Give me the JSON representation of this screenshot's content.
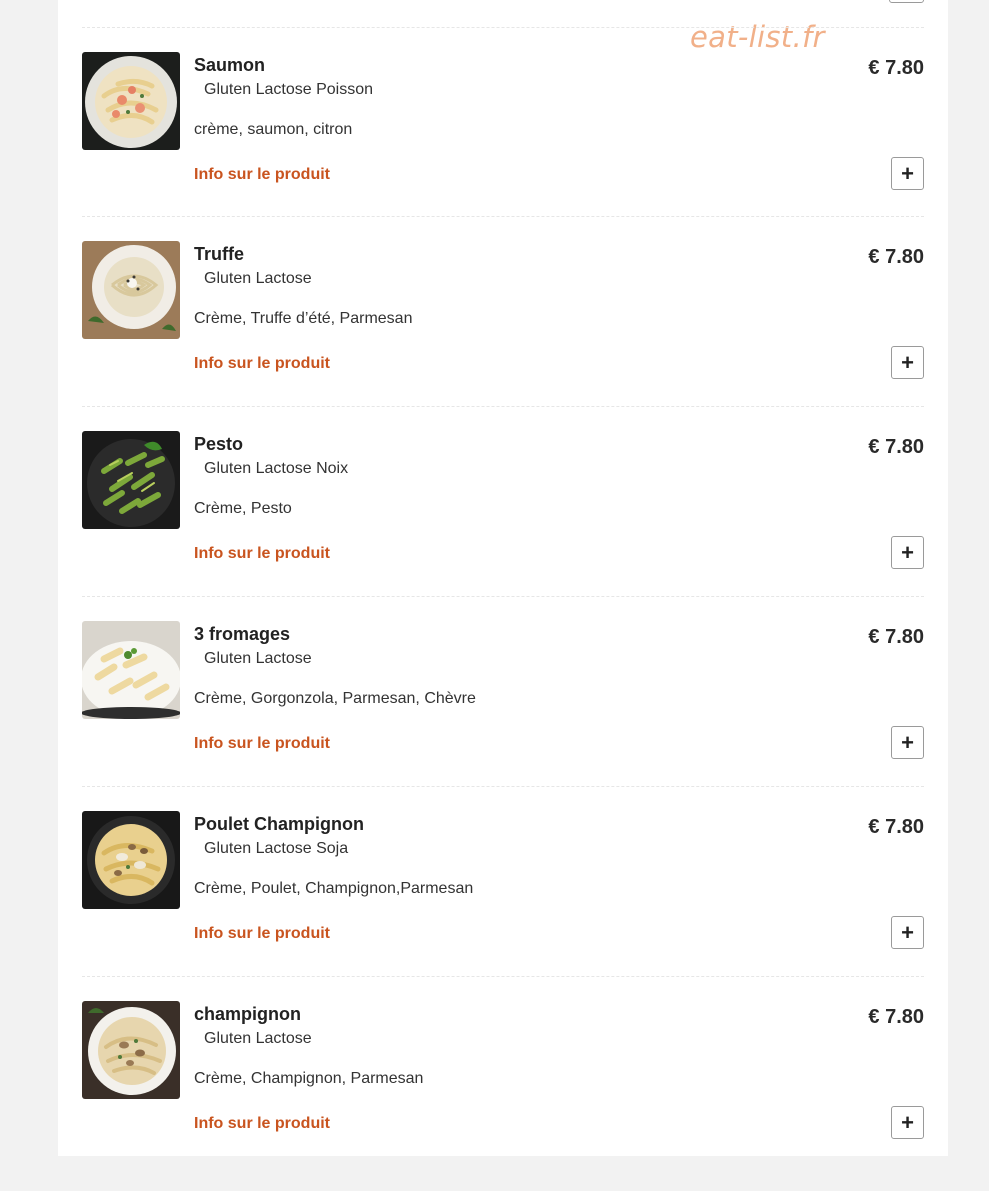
{
  "watermark": "eat-list.fr",
  "items": [
    {
      "name": "Saumon",
      "allergens": "Gluten Lactose Poisson",
      "description": "crème, saumon, citron",
      "info": "Info sur le produit",
      "price": "€ 7.80",
      "add": "+"
    },
    {
      "name": "Truffe",
      "allergens": "Gluten Lactose",
      "description": "Crème, Truffe d’été, Parmesan",
      "info": "Info sur le produit",
      "price": "€ 7.80",
      "add": "+"
    },
    {
      "name": "Pesto",
      "allergens": "Gluten Lactose Noix",
      "description": "Crème, Pesto",
      "info": "Info sur le produit",
      "price": "€ 7.80",
      "add": "+"
    },
    {
      "name": "3 fromages",
      "allergens": "Gluten Lactose",
      "description": "Crème, Gorgonzola, Parmesan, Chèvre",
      "info": "Info sur le produit",
      "price": "€ 7.80",
      "add": "+"
    },
    {
      "name": "Poulet Champignon",
      "allergens": "Gluten Lactose Soja",
      "description": "Crème, Poulet, Champignon,Parmesan",
      "info": "Info sur le produit",
      "price": "€ 7.80",
      "add": "+"
    },
    {
      "name": "champignon",
      "allergens": "Gluten Lactose",
      "description": "Crème, Champignon, Parmesan",
      "info": "Info sur le produit",
      "price": "€ 7.80",
      "add": "+"
    }
  ],
  "colors": {
    "link": "#c9541f",
    "watermark": "#f1b089"
  }
}
